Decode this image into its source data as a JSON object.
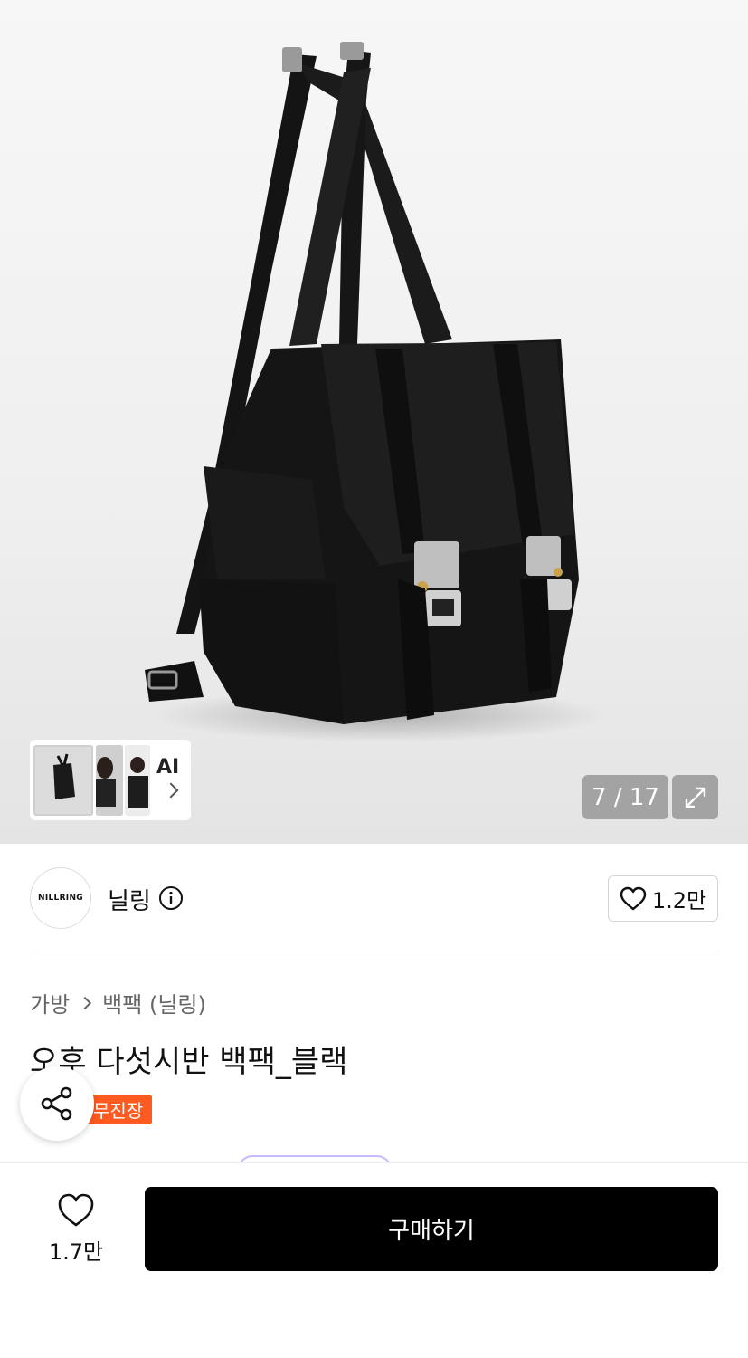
{
  "gallery": {
    "current": "7",
    "total": "17",
    "counter_text": "7 / 17",
    "ai_label": "AI",
    "icons": [
      "expand-icon",
      "chevron-right-icon"
    ]
  },
  "brand": {
    "logo_text": "NILLRING",
    "name": "닐링",
    "like_count": "1.2만"
  },
  "breadcrumb": {
    "category": "가방",
    "subcategory": "백팩 (닐링)"
  },
  "product": {
    "title": "오후 다섯시반 백팩_블랙",
    "badge": "무진장"
  },
  "bottom_bar": {
    "like_count": "1.7만",
    "buy_label": "구매하기"
  },
  "colors": {
    "badge": "#ff5a1f",
    "buy_button": "#000000"
  }
}
